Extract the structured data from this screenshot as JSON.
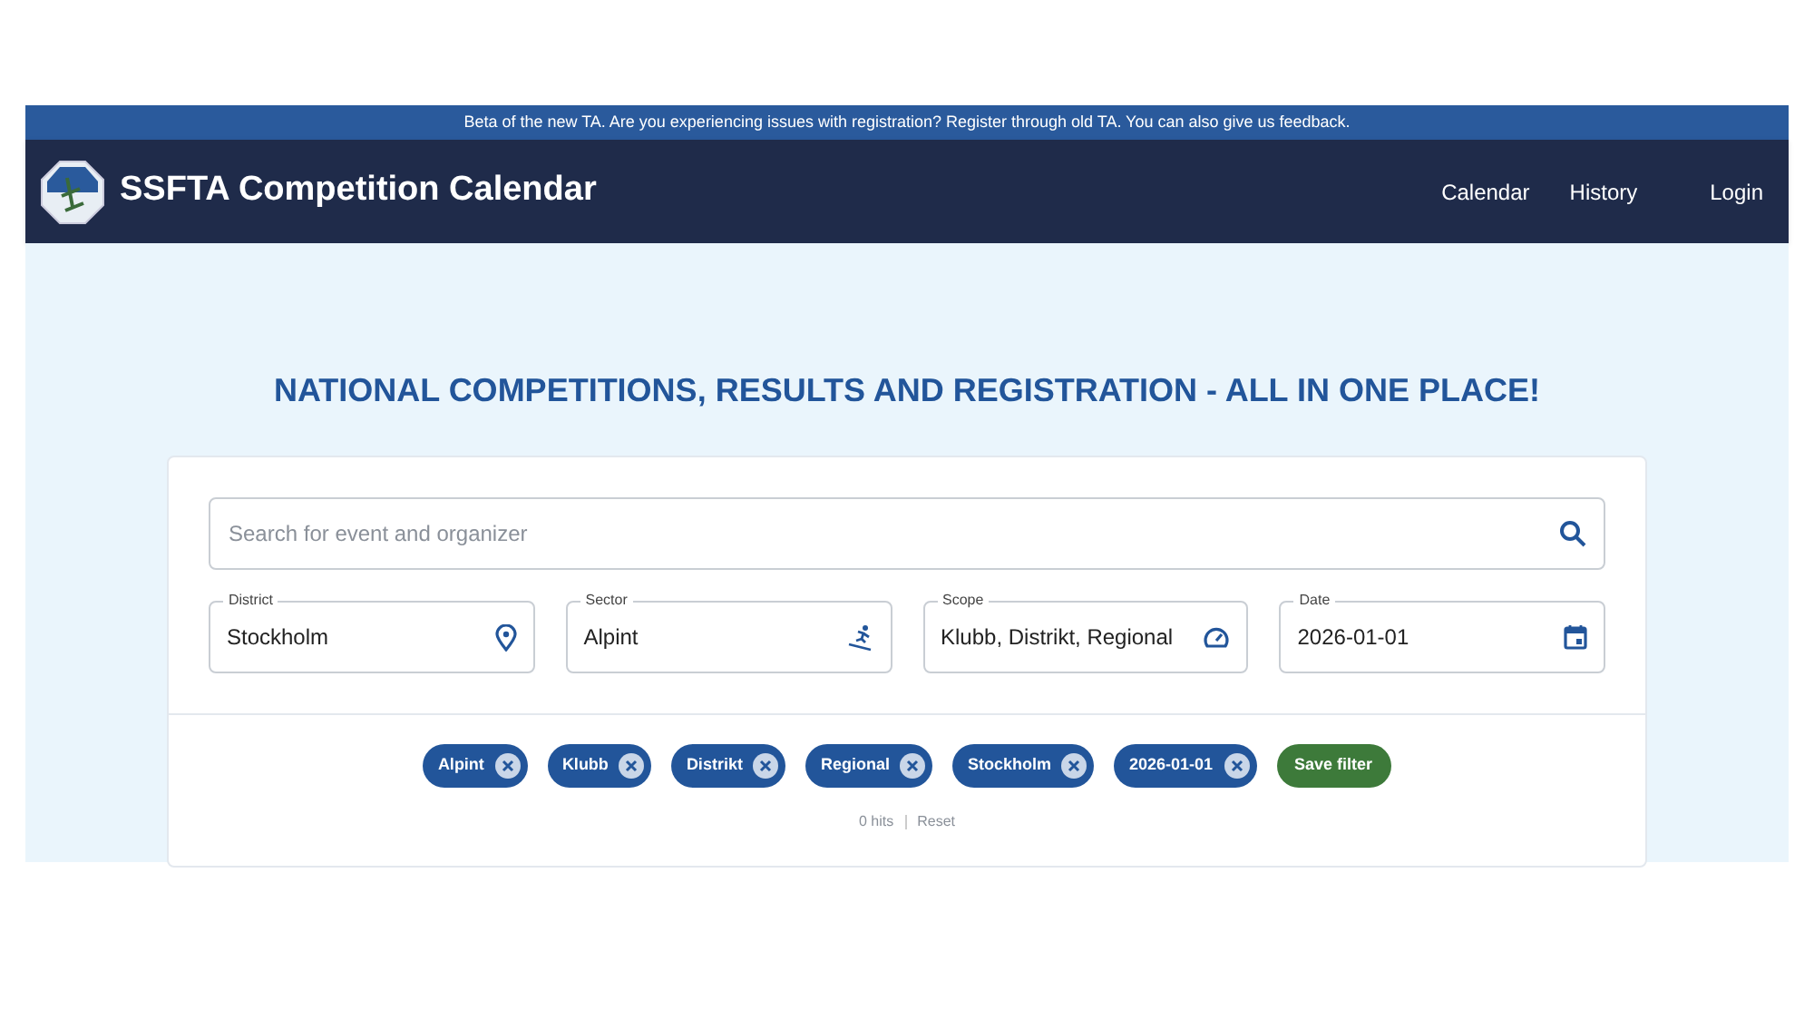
{
  "banner": "Beta of the new TA. Are you experiencing issues with registration? Register through old TA. You can also give us feedback.",
  "header": {
    "title": "SSFTA Competition Calendar",
    "nav": [
      "Calendar",
      "History"
    ],
    "login": "Login"
  },
  "headline": "NATIONAL COMPETITIONS, RESULTS AND REGISTRATION - ALL IN ONE PLACE!",
  "search": {
    "placeholder": "Search for event and organizer"
  },
  "filters": [
    {
      "label": "District",
      "value": "Stockholm",
      "kind": "pin"
    },
    {
      "label": "Sector",
      "value": "Alpint",
      "kind": "skier"
    },
    {
      "label": "Scope",
      "value": "Klubb, Distrikt, Regional",
      "kind": "gauge"
    },
    {
      "label": "Date",
      "value": "2026-01-01",
      "kind": "calendar"
    }
  ],
  "chips": [
    "Alpint",
    "Klubb",
    "Distrikt",
    "Regional",
    "Stockholm",
    "2026-01-01"
  ],
  "save_filter": "Save filter",
  "hits": "0 hits",
  "reset": "Reset"
}
